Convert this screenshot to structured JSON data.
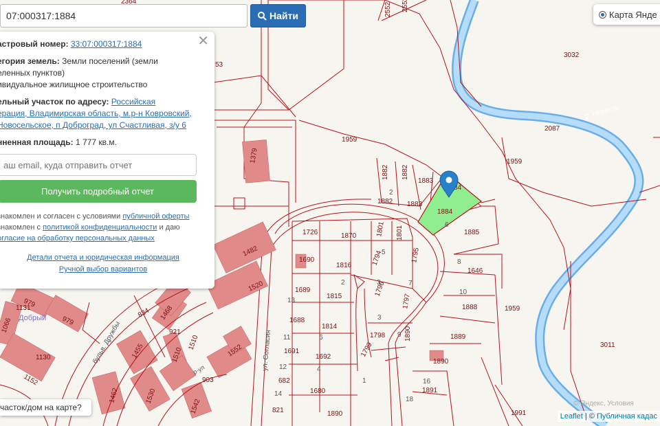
{
  "search": {
    "value": "07:000317:1884",
    "button_label": "Найти"
  },
  "panel": {
    "cadastral_label": "астровый номер:",
    "cadastral_value": "33:07:000317:1884",
    "category_label": "егория земель:",
    "category_value_1": "Земли поселений (земли",
    "category_value_2": "еленных пунктов)",
    "usage": "ивидуальное жилищное строительство",
    "address_label": "ельный участок по адресу:",
    "address_link_1": "Российская",
    "address_link_2": "ерация, Владимирская область, м.р-н Ковровский,",
    "address_link_3": "Новосельское, п Доброград, ул Счастливая, з/у 6",
    "area_label": "нненная площадь:",
    "area_value": "1 777 кв.м.",
    "email_placeholder": "аш email, куда отправить отчет",
    "report_button": "Получить подробный отчет",
    "consent_1_text": "знакомлен и согласен с условиями",
    "consent_1_link": "публичной оферты",
    "consent_2_text": "знакомлен с",
    "consent_2_link": "политикой конфиденциальности",
    "consent_2_tail": "и даю",
    "consent_3_link": "огласие на обработку персональных данных",
    "details_link": "Детали отчета и юридическая информация",
    "manual_link": "Ручной выбор вариантов"
  },
  "layer_control": {
    "label": "Карта Янде"
  },
  "bottom_button": {
    "label": "часток/дом на карте?"
  },
  "attribution": {
    "leaflet": "Leaflet",
    "sep": " | © ",
    "source": "Публичная кадас"
  },
  "copyright": "© Яндекс, Условия",
  "map": {
    "river_label": "р. Нерехта",
    "streets": [
      "ул. Согласия",
      "бульв. Дружбы",
      "р-ул",
      "Добрый"
    ],
    "selected_parcel": "1884",
    "colors": {
      "parcel_border": "#b5121b",
      "selected_fill": "#90ee90",
      "building": "#e08a8a",
      "river": "#a9d3f5",
      "button_blue": "#2a6db4",
      "button_green": "#5cb85c"
    },
    "parcel_labels": [
      "2364",
      "2552",
      "2552",
      "3032",
      "53",
      "2087",
      "1959",
      "1959",
      "1882",
      "1882",
      "1882",
      "1883",
      "1883",
      "1884",
      "84",
      "1885",
      "1726",
      "1870",
      "1801",
      "1801",
      "1795",
      "1646",
      "1690",
      "1816",
      "1794",
      "1689",
      "1815",
      "1796",
      "1888",
      "1959",
      "1688",
      "1814",
      "1797",
      "1798",
      "1889",
      "3011",
      "1691",
      "1692",
      "1890",
      "1890",
      "1799",
      "682",
      "1680",
      "1891",
      "1991",
      "821",
      "1890",
      "1482",
      "1520",
      "1379",
      "979",
      "979",
      "834",
      "1468",
      "921",
      "1510",
      "1510",
      "1066",
      "1131",
      "1130",
      "1152",
      "1455",
      "1552",
      "903",
      "1530",
      "1542",
      "1462"
    ],
    "small_numbers": [
      "2",
      "6",
      "8",
      "5",
      "7",
      "10",
      "13",
      "11",
      "12",
      "1",
      "3",
      "2",
      "4",
      "6",
      "9",
      "16",
      "18",
      "14",
      "3"
    ]
  }
}
